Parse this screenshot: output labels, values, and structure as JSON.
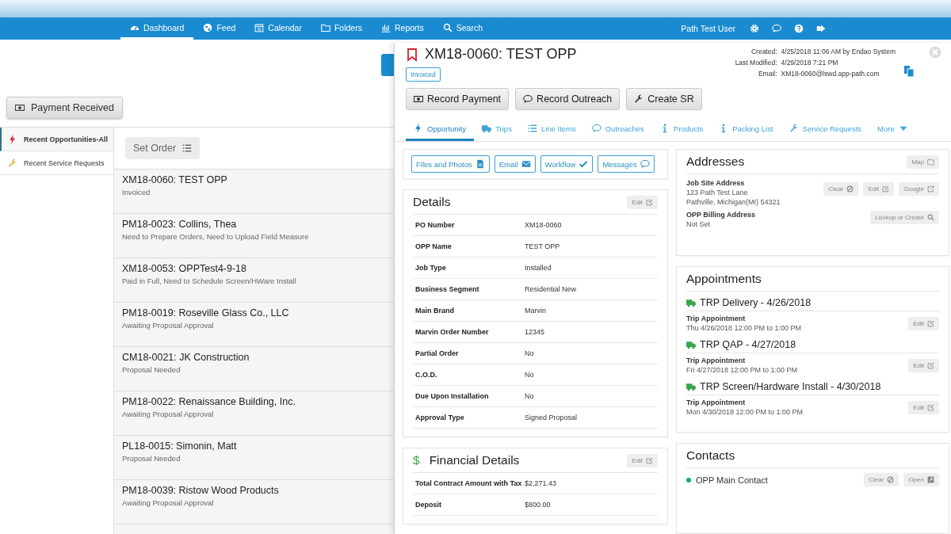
{
  "nav": {
    "items": [
      {
        "label": "Dashboard",
        "selected": true
      },
      {
        "label": "Feed",
        "selected": false
      },
      {
        "label": "Calendar",
        "selected": false
      },
      {
        "label": "Folders",
        "selected": false
      },
      {
        "label": "Reports",
        "selected": false
      },
      {
        "label": "Search",
        "selected": false
      }
    ],
    "user": "Path Test User"
  },
  "left": {
    "payment_button": "Payment Received",
    "sidebar": [
      {
        "label": "Recent Opportunities-All",
        "selected": true
      },
      {
        "label": "Recent Service Requests",
        "selected": false
      }
    ],
    "set_order": "Set Order",
    "list": [
      {
        "title": "XM18-0060: TEST OPP",
        "subtitle": "Invoiced"
      },
      {
        "title": "PM18-0023: Collins, Thea",
        "subtitle": "Need to Prepare Orders, Need to Upload Field Measure"
      },
      {
        "title": "XM18-0053: OPPTest4-9-18",
        "subtitle": "Paid in Full, Need to Schedule Screen/HWare Install"
      },
      {
        "title": "PM18-0019: Roseville Glass Co., LLC",
        "subtitle": "Awaiting Proposal Approval"
      },
      {
        "title": "CM18-0021: JK Construction",
        "subtitle": "Proposal Needed"
      },
      {
        "title": "PM18-0022: Renaissance Building, Inc.",
        "subtitle": "Awaiting Proposal Approval"
      },
      {
        "title": "PL18-0015: Simonin, Matt",
        "subtitle": "Proposal Needed"
      },
      {
        "title": "PM18-0039: Ristow Wood Products",
        "subtitle": "Awaiting Proposal Approval"
      }
    ]
  },
  "record": {
    "title": "XM18-0060: TEST OPP",
    "status": "Invoiced",
    "meta": [
      {
        "label": "Created:",
        "value": "4/25/2018 11:06 AM by Endao System"
      },
      {
        "label": "Last Modified:",
        "value": "4/29/2018 7:21 PM"
      },
      {
        "label": "Email:",
        "value": "XM18-0060@lswd.app-path.com"
      }
    ],
    "actions": [
      "Record Payment",
      "Record Outreach",
      "Create SR"
    ],
    "tabs": [
      {
        "label": "Opportunity",
        "selected": true
      },
      {
        "label": "Trips",
        "selected": false
      },
      {
        "label": "Line Items",
        "selected": false
      },
      {
        "label": "Outreaches",
        "selected": false
      },
      {
        "label": "Products",
        "selected": false
      },
      {
        "label": "Packing List",
        "selected": false
      },
      {
        "label": "Service Requests",
        "selected": false
      },
      {
        "label": "More",
        "selected": false
      }
    ],
    "quick_buttons": [
      "Files and Photos",
      "Email",
      "Workflow",
      "Messages"
    ],
    "details": {
      "title": "Details",
      "edit": "Edit",
      "rows": [
        {
          "label": "PO Number",
          "value": "XM18-0060"
        },
        {
          "label": "OPP Name",
          "value": "TEST OPP"
        },
        {
          "label": "Job Type",
          "value": "Installed"
        },
        {
          "label": "Business Segment",
          "value": "Residential New"
        },
        {
          "label": "Main Brand",
          "value": "Marvin"
        },
        {
          "label": "Marvin Order Number",
          "value": "12345"
        },
        {
          "label": "Partial Order",
          "value": "No"
        },
        {
          "label": "C.O.D.",
          "value": "No"
        },
        {
          "label": "Due Upon Installation",
          "value": "No"
        },
        {
          "label": "Approval Type",
          "value": "Signed Proposal"
        }
      ]
    },
    "financial": {
      "icon": "$",
      "title": "Financial Details",
      "edit": "Edit",
      "rows": [
        {
          "label": "Total Contract Amount with Tax",
          "value": "$2,271.43"
        },
        {
          "label": "Deposit",
          "value": "$800.00"
        }
      ]
    },
    "addresses": {
      "title": "Addresses",
      "map": "Map",
      "job_site": {
        "label": "Job Site Address",
        "lines": [
          "123 Path Test Lane",
          "Pathville, Michigan(MI) 54321"
        ],
        "buttons": [
          "Clear",
          "Edit",
          "Google"
        ]
      },
      "billing": {
        "label": "OPP Billing Address",
        "value": "Not Set",
        "button": "Lookup or Create"
      }
    },
    "appointments": {
      "title": "Appointments",
      "items": [
        {
          "title": "TRP Delivery - 4/26/2018",
          "type": "Trip Appointment",
          "time": "Thu 4/26/2018 12:00 PM to 1:00 PM",
          "edit": "Edit"
        },
        {
          "title": "TRP QAP - 4/27/2018",
          "type": "Trip Appointment",
          "time": "Fri 4/27/2018 12:00 PM to 1:00 PM",
          "edit": "Edit"
        },
        {
          "title": "TRP Screen/Hardware Install - 4/30/2018",
          "type": "Trip Appointment",
          "time": "Mon 4/30/2018 12:00 PM to 1:00 PM",
          "edit": "Edit"
        }
      ]
    },
    "contacts": {
      "title": "Contacts",
      "items": [
        {
          "name": "OPP Main Contact",
          "color": "#1aa37a",
          "buttons": [
            "Clear",
            "Open"
          ]
        }
      ]
    }
  }
}
